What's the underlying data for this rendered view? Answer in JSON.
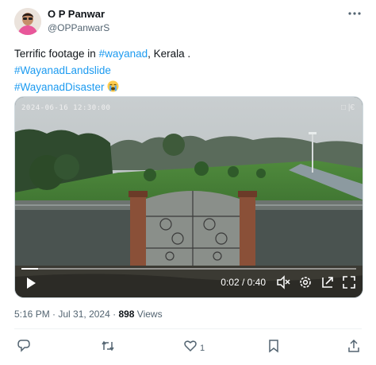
{
  "author": {
    "name": "O P Panwar",
    "handle": "@OPPanwarS",
    "avatar": "avatar"
  },
  "more_icon": "more-icon",
  "tweet": {
    "line1_text": "Terrific footage in ",
    "line1_tag": "#wayanad",
    "line1_suffix": ", Kerala .",
    "tag2": "#WayanadLandslide",
    "tag3": "#WayanadDisaster",
    "emoji": "crying-face-emoji"
  },
  "video": {
    "timestamp": "2024-06-16  12:30:00",
    "watermark": "□ |€",
    "timecode": "0:02 / 0:40",
    "progress": 0.05,
    "controls": [
      "play-icon",
      "mute-icon",
      "settings-icon",
      "pip-icon",
      "fullscreen-icon"
    ]
  },
  "meta": {
    "time": "5:16 PM",
    "separator": " · ",
    "date": "Jul 31, 2024",
    "views_count": "898",
    "views_label": " Views"
  },
  "actions": {
    "like_count": "1",
    "icons": [
      "reply-icon",
      "retweet-icon",
      "like-icon",
      "bookmark-icon",
      "share-icon"
    ]
  },
  "colors": {
    "link": "#1d9bf0",
    "text": "#0f1419",
    "secondary": "#536471"
  }
}
